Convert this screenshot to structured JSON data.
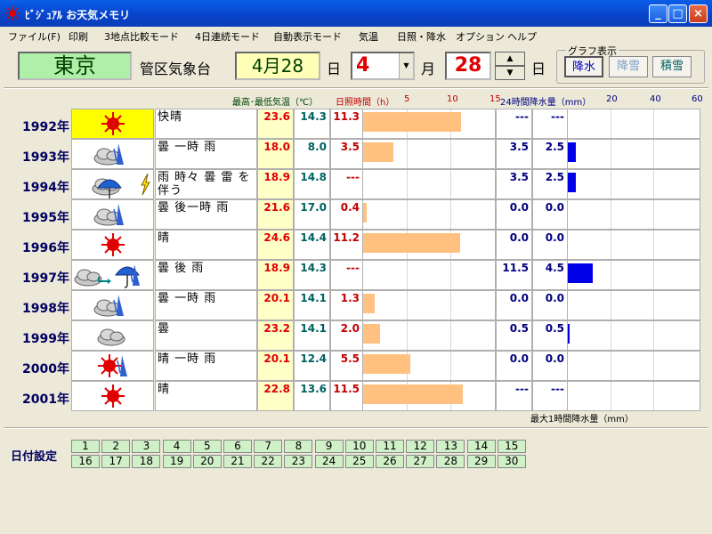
{
  "window": {
    "title": "ﾋﾞｼﾞｭｱﾙ お天気メモリ",
    "minimize": "_",
    "maximize": "□",
    "close": "×"
  },
  "menu": [
    "ファイル(F)",
    "印刷",
    "3地点比較モード",
    "4日連続モード",
    "自動表示モード",
    "気温",
    "日照・降水",
    "オプション",
    "ヘルプ"
  ],
  "header": {
    "city": "東京",
    "office_label": "管区気象台",
    "date_display": "4月28",
    "day_unit": "日",
    "month_value": "4",
    "month_unit": "月",
    "day_value": "28",
    "day_unit2": "日",
    "graph_group_title": "グラフ表示",
    "graph_buttons": [
      "降水",
      "降雪",
      "積雪"
    ]
  },
  "table_headers": {
    "temp": "最高･最低気温（℃）",
    "sunshine": "日照時間（h）",
    "sun_ticks": [
      "5",
      "10",
      "15"
    ],
    "rain24": "24時間降水量（mm）",
    "rain_ticks": [
      "20",
      "40",
      "60"
    ],
    "max_rain": "最大1時間降水量（mm）"
  },
  "rows": [
    {
      "year": "1992年",
      "icon": "sun-icon",
      "weather": "快晴",
      "max": "23.6",
      "min": "14.3",
      "sun": "11.3",
      "sun_hours": 11.3,
      "rain24": "---",
      "rain1h": "---",
      "rain24_mm": 0,
      "highlight": true
    },
    {
      "year": "1993年",
      "icon": "cloud-then-rain-icon",
      "weather": "曇 一時 雨",
      "max": "18.0",
      "min": "8.0",
      "sun": "3.5",
      "sun_hours": 3.5,
      "rain24": "3.5",
      "rain1h": "2.5",
      "rain24_mm": 3.5,
      "highlight": false
    },
    {
      "year": "1994年",
      "icon": "rain-thunder-icon",
      "weather": "雨 時々 曇 雷 を 伴う",
      "max": "18.9",
      "min": "14.8",
      "sun": "---",
      "sun_hours": 0,
      "rain24": "3.5",
      "rain1h": "2.5",
      "rain24_mm": 3.5,
      "highlight": false
    },
    {
      "year": "1995年",
      "icon": "cloud-then-rain-icon",
      "weather": "曇 後一時 雨",
      "max": "21.6",
      "min": "17.0",
      "sun": "0.4",
      "sun_hours": 0.4,
      "rain24": "0.0",
      "rain1h": "0.0",
      "rain24_mm": 0,
      "highlight": false
    },
    {
      "year": "1996年",
      "icon": "sun-icon",
      "weather": "晴",
      "max": "24.6",
      "min": "14.4",
      "sun": "11.2",
      "sun_hours": 11.2,
      "rain24": "0.0",
      "rain1h": "0.0",
      "rain24_mm": 0,
      "highlight": false
    },
    {
      "year": "1997年",
      "icon": "cloud-to-rain-icon",
      "weather": "曇 後 雨",
      "max": "18.9",
      "min": "14.3",
      "sun": "---",
      "sun_hours": 0,
      "rain24": "11.5",
      "rain1h": "4.5",
      "rain24_mm": 11.5,
      "highlight": false
    },
    {
      "year": "1998年",
      "icon": "cloud-then-rain-icon",
      "weather": "曇 一時 雨",
      "max": "20.1",
      "min": "14.1",
      "sun": "1.3",
      "sun_hours": 1.3,
      "rain24": "0.0",
      "rain1h": "0.0",
      "rain24_mm": 0,
      "highlight": false
    },
    {
      "year": "1999年",
      "icon": "cloud-icon",
      "weather": "曇",
      "max": "23.2",
      "min": "14.1",
      "sun": "2.0",
      "sun_hours": 2.0,
      "rain24": "0.5",
      "rain1h": "0.5",
      "rain24_mm": 0.5,
      "highlight": false
    },
    {
      "year": "2000年",
      "icon": "sun-then-rain-icon",
      "weather": "晴 一時 雨",
      "max": "20.1",
      "min": "12.4",
      "sun": "5.5",
      "sun_hours": 5.5,
      "rain24": "0.0",
      "rain1h": "0.0",
      "rain24_mm": 0,
      "highlight": false
    },
    {
      "year": "2001年",
      "icon": "sun-icon",
      "weather": "晴",
      "max": "22.8",
      "min": "13.6",
      "sun": "11.5",
      "sun_hours": 11.5,
      "rain24": "---",
      "rain1h": "---",
      "rain24_mm": 0,
      "highlight": false
    }
  ],
  "date_setting_label": "日付設定",
  "date_buttons": [
    "1",
    "2",
    "3",
    "4",
    "5",
    "6",
    "7",
    "8",
    "9",
    "10",
    "11",
    "12",
    "13",
    "14",
    "15",
    "16",
    "17",
    "18",
    "19",
    "20",
    "21",
    "22",
    "23",
    "24",
    "25",
    "26",
    "27",
    "28",
    "29",
    "30"
  ],
  "colors": {
    "sun_bar": "#ffc080",
    "rain_bar": "#0000e8",
    "max_temp_bg": "#ffffc8",
    "date_btn_bg": "#d0f0c8"
  }
}
